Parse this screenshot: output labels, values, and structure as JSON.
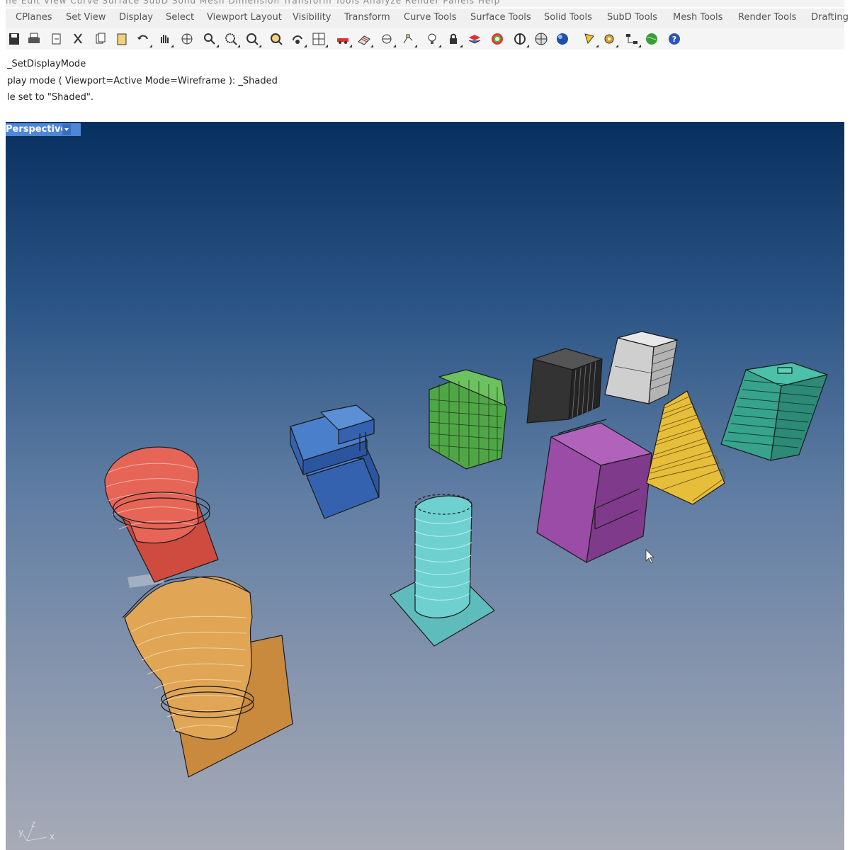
{
  "menu_strip_ghost": "ile   Edit   View   Curve   Surface   SubD   Solid   Mesh   Dimension   Transform   Tools   Analyze   Render   Panels   Help",
  "tabs": [
    "CPlanes",
    "Set View",
    "Display",
    "Select",
    "Viewport Layout",
    "Visibility",
    "Transform",
    "Curve Tools",
    "Surface Tools",
    "Solid Tools",
    "SubD Tools",
    "Mesh Tools",
    "Render Tools",
    "Drafting"
  ],
  "toolbar_icons": [
    "save-icon",
    "print-icon",
    "import-icon",
    "cut-icon",
    "copy-icon",
    "paste-icon",
    "undo-icon",
    "pan-hand-icon",
    "rotate-view-icon",
    "zoom-icon",
    "zoom-window-icon",
    "zoom-extents-icon",
    "zoom-selected-icon",
    "rotate-camera-icon",
    "four-viewports-icon",
    "car-icon",
    "grid-icon",
    "cplane-icon",
    "snap-icon",
    "light-icon",
    "lock-icon",
    "layer-icon",
    "color-wheel-icon",
    "circle-cross-icon",
    "sphere-grid-icon",
    "sphere-icon",
    "triangle-flag-icon",
    "gear-icon",
    "node-icon",
    "globe-icon",
    "help-icon"
  ],
  "command_history": [
    "_SetDisplayMode",
    "play mode ( Viewport=Active  Mode=Wireframe ): _Shaded",
    "le set to \"Shaded\"."
  ],
  "viewport": {
    "name": "Perspective",
    "display_mode": "Shaded"
  },
  "axes": {
    "x": "x",
    "y": "y",
    "z": "z"
  },
  "colors": {
    "red_tower": "#e0594a",
    "orange_tower": "#d99a4a",
    "blue_blocks": "#3d6fbe",
    "green_voxels": "#52a84a",
    "cyan_cylinder": "#5fbcbc",
    "black_box": "#3a3a3a",
    "white_box": "#cfcfcf",
    "purple_box": "#9e52a8",
    "yellow_stairs": "#e3bb3a",
    "teal_slabs": "#3aa893",
    "viewport_label": "#4f86d6"
  }
}
